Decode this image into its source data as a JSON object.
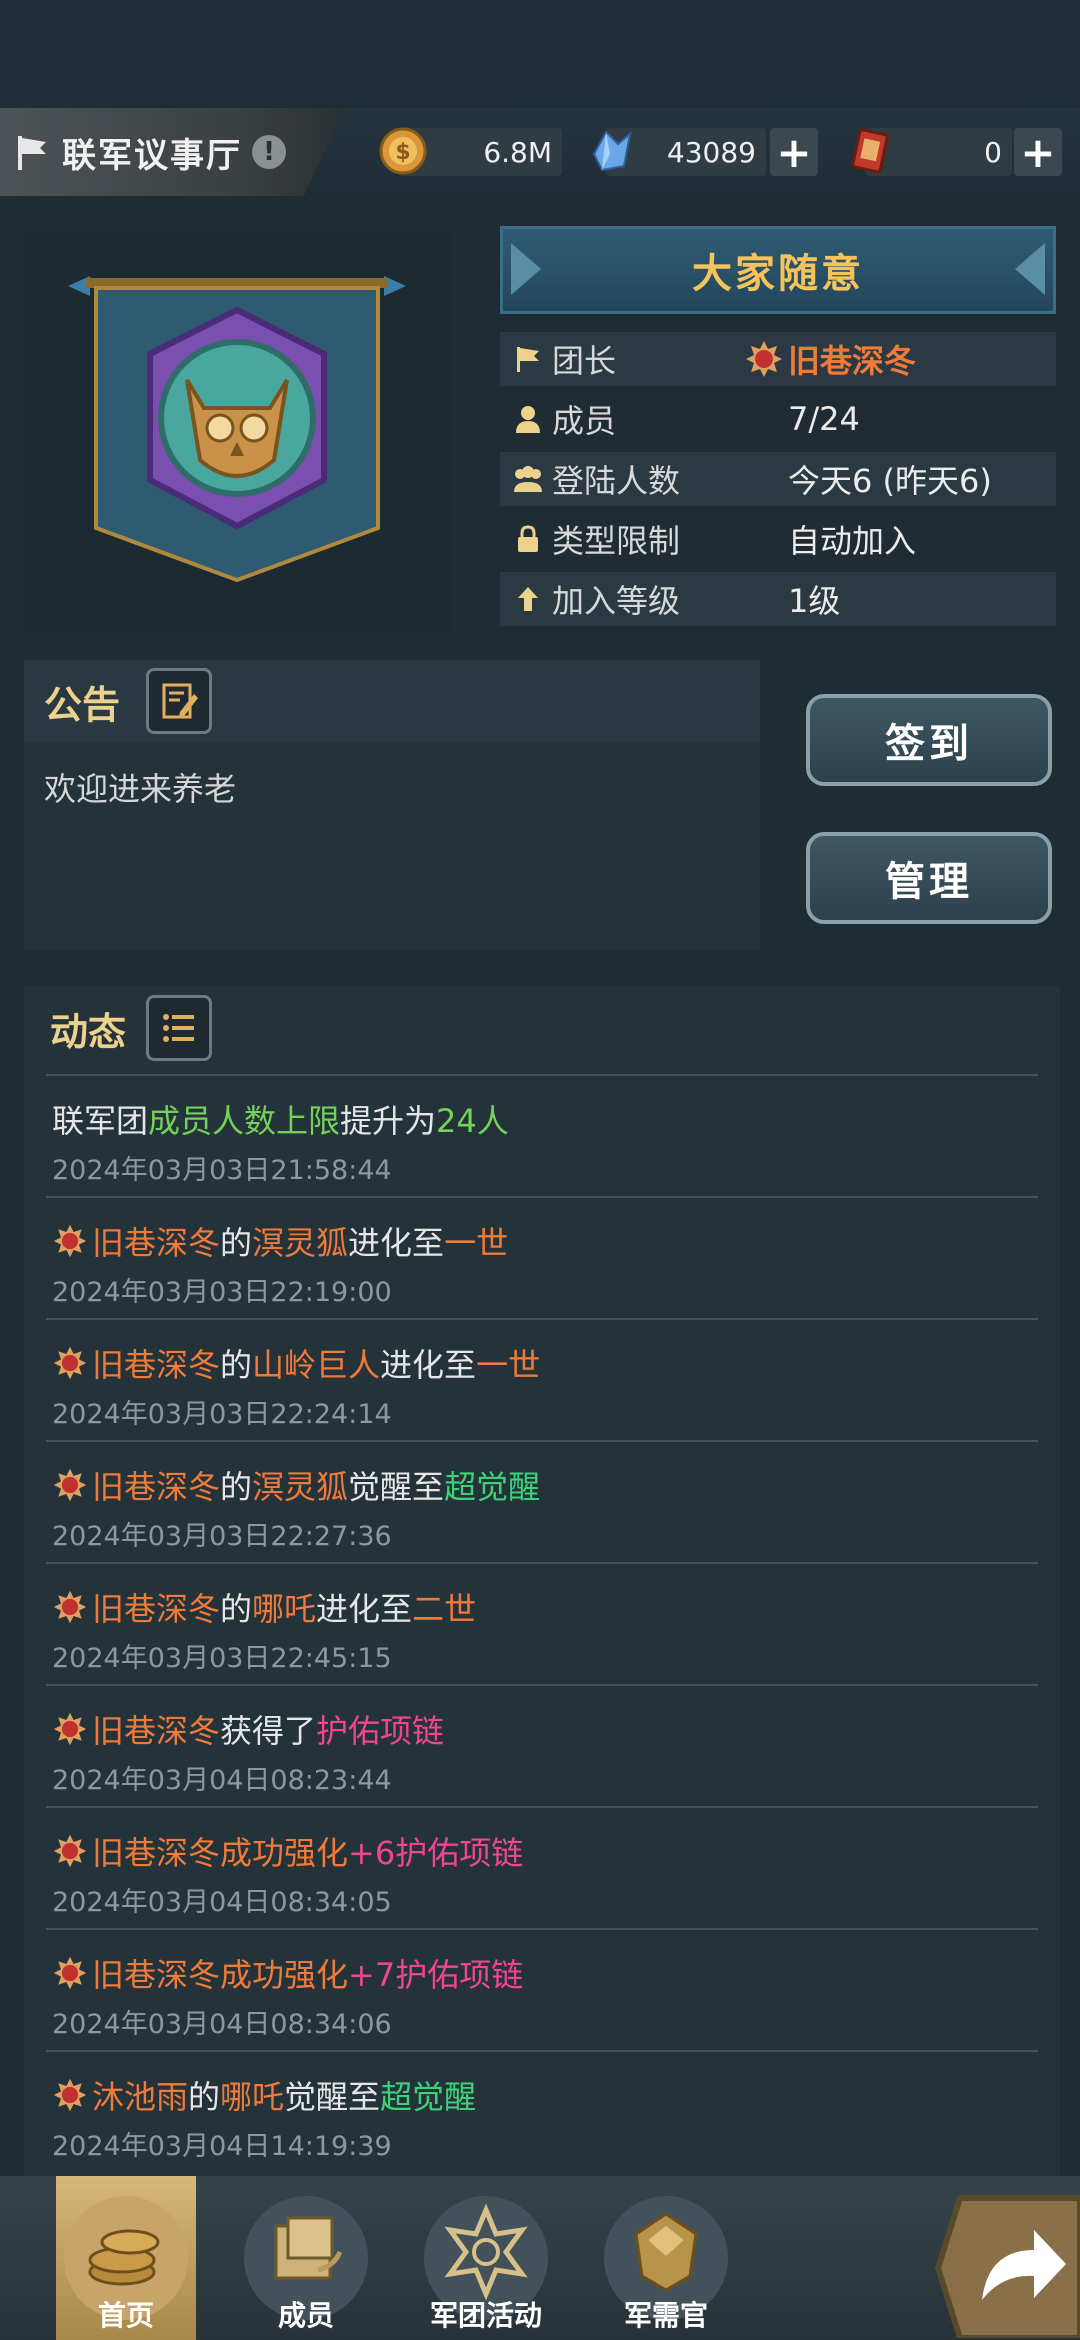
{
  "header": {
    "title": "联军议事厅",
    "resources": [
      {
        "icon": "gold-coin-icon",
        "value": "6.8M"
      },
      {
        "icon": "crystal-icon",
        "value": "43089"
      },
      {
        "icon": "ticket-card-icon",
        "value": "0"
      }
    ]
  },
  "guild": {
    "name": "大家随意",
    "emblem": "owl-emblem-banner",
    "info": [
      {
        "icon": "flag-icon",
        "label": "团长",
        "value": "旧巷深冬"
      },
      {
        "icon": "person-icon",
        "label": "成员",
        "value": "7/24"
      },
      {
        "icon": "group-icon",
        "label": "登陆人数",
        "value": "今天6 (昨天6)"
      },
      {
        "icon": "lock-icon",
        "label": "类型限制",
        "value": "自动加入"
      },
      {
        "icon": "arrow-up-icon",
        "label": "加入等级",
        "value": "1级"
      }
    ]
  },
  "notice": {
    "title": "公告",
    "text": "欢迎进来养老"
  },
  "actions": {
    "checkin": "签到",
    "manage": "管理"
  },
  "feed": {
    "title": "动态",
    "items": [
      {
        "rank_icon": false,
        "segments": [
          {
            "t": "联军团",
            "c": "white"
          },
          {
            "t": "成员人数上限",
            "c": "green"
          },
          {
            "t": "提升为",
            "c": "white"
          },
          {
            "t": "24人",
            "c": "green"
          }
        ],
        "time": "2024年03月03日21:58:44"
      },
      {
        "rank_icon": true,
        "segments": [
          {
            "t": "旧巷深冬",
            "c": "orange"
          },
          {
            "t": "的",
            "c": "white"
          },
          {
            "t": "溟灵狐",
            "c": "orange"
          },
          {
            "t": "进化至",
            "c": "white"
          },
          {
            "t": "一世",
            "c": "orange"
          }
        ],
        "time": "2024年03月03日22:19:00"
      },
      {
        "rank_icon": true,
        "segments": [
          {
            "t": "旧巷深冬",
            "c": "orange"
          },
          {
            "t": "的",
            "c": "white"
          },
          {
            "t": "山岭巨人",
            "c": "orange"
          },
          {
            "t": "进化至",
            "c": "white"
          },
          {
            "t": "一世",
            "c": "orange"
          }
        ],
        "time": "2024年03月03日22:24:14"
      },
      {
        "rank_icon": true,
        "segments": [
          {
            "t": "旧巷深冬",
            "c": "orange"
          },
          {
            "t": "的",
            "c": "white"
          },
          {
            "t": "溟灵狐",
            "c": "orange"
          },
          {
            "t": "觉醒至",
            "c": "white"
          },
          {
            "t": "超觉醒",
            "c": "teal"
          }
        ],
        "time": "2024年03月03日22:27:36"
      },
      {
        "rank_icon": true,
        "segments": [
          {
            "t": "旧巷深冬",
            "c": "orange"
          },
          {
            "t": "的",
            "c": "white"
          },
          {
            "t": "哪吒",
            "c": "orange"
          },
          {
            "t": "进化至",
            "c": "white"
          },
          {
            "t": "二世",
            "c": "orange"
          }
        ],
        "time": "2024年03月03日22:45:15"
      },
      {
        "rank_icon": true,
        "segments": [
          {
            "t": "旧巷深冬",
            "c": "orange"
          },
          {
            "t": "获得了",
            "c": "white"
          },
          {
            "t": "护佑项链",
            "c": "pink"
          }
        ],
        "time": "2024年03月04日08:23:44"
      },
      {
        "rank_icon": true,
        "segments": [
          {
            "t": "旧巷深冬",
            "c": "orange"
          },
          {
            "t": "成功强化",
            "c": "orange"
          },
          {
            "t": "+6护佑项链",
            "c": "pink"
          }
        ],
        "time": "2024年03月04日08:34:05"
      },
      {
        "rank_icon": true,
        "segments": [
          {
            "t": "旧巷深冬",
            "c": "orange"
          },
          {
            "t": "成功强化",
            "c": "orange"
          },
          {
            "t": "+7护佑项链",
            "c": "pink"
          }
        ],
        "time": "2024年03月04日08:34:06"
      },
      {
        "rank_icon": true,
        "segments": [
          {
            "t": "沐池雨",
            "c": "orange"
          },
          {
            "t": "的",
            "c": "white"
          },
          {
            "t": "哪吒",
            "c": "orange"
          },
          {
            "t": "觉醒至",
            "c": "white"
          },
          {
            "t": "超觉醒",
            "c": "teal"
          }
        ],
        "time": "2024年03月04日14:19:39"
      }
    ]
  },
  "nav": {
    "items": [
      {
        "label": "首页",
        "icon": "coins-icon",
        "active": true
      },
      {
        "label": "成员",
        "icon": "members-icon",
        "active": false
      },
      {
        "label": "军团活动",
        "icon": "star-badge-icon",
        "active": false
      },
      {
        "label": "军需官",
        "icon": "helmet-icon",
        "active": false
      }
    ],
    "share_icon": "share-arrow-icon"
  },
  "colors": {
    "accent_gold": "#ecd28c",
    "name_orange": "#f07a3a",
    "highlight_green": "#74d15a",
    "item_pink": "#f0468e",
    "awaken_green": "#3fd17a"
  }
}
